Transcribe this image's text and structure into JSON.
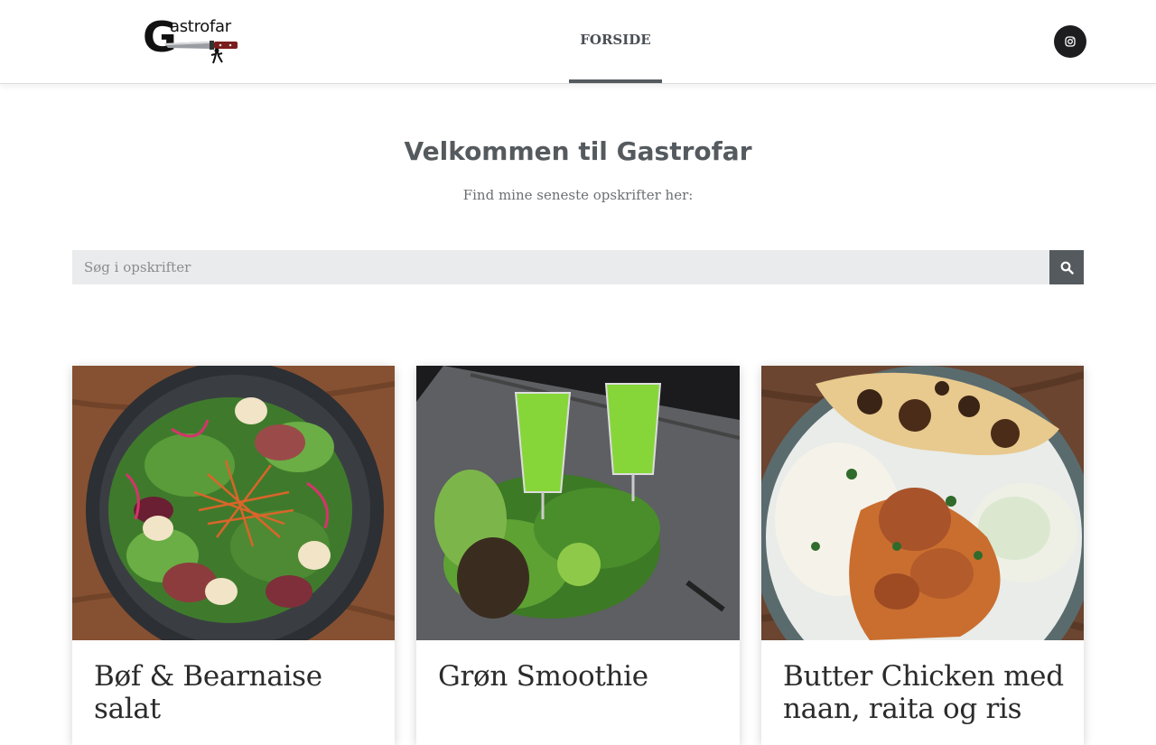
{
  "header": {
    "logo_text": "Gastrofar",
    "nav": [
      {
        "label": "FORSIDE",
        "active": true
      }
    ],
    "social": {
      "icon": "instagram-icon"
    }
  },
  "hero": {
    "title": "Velkommen til Gastrofar",
    "subtitle": "Find mine seneste opskrifter her:"
  },
  "search": {
    "placeholder": "Søg i opskrifter",
    "value": "",
    "button_icon": "search-icon"
  },
  "recipes": [
    {
      "title": "Bøf & Bearnaise salat"
    },
    {
      "title": "Grøn Smoothie"
    },
    {
      "title": "Butter Chicken med naan, raita og ris"
    }
  ],
  "colors": {
    "primary": "#555a5e",
    "header_border": "#dcdcdc",
    "search_bg": "#eaebec",
    "social_bg": "#1d1d1f",
    "card_title": "#2b2b2b"
  }
}
